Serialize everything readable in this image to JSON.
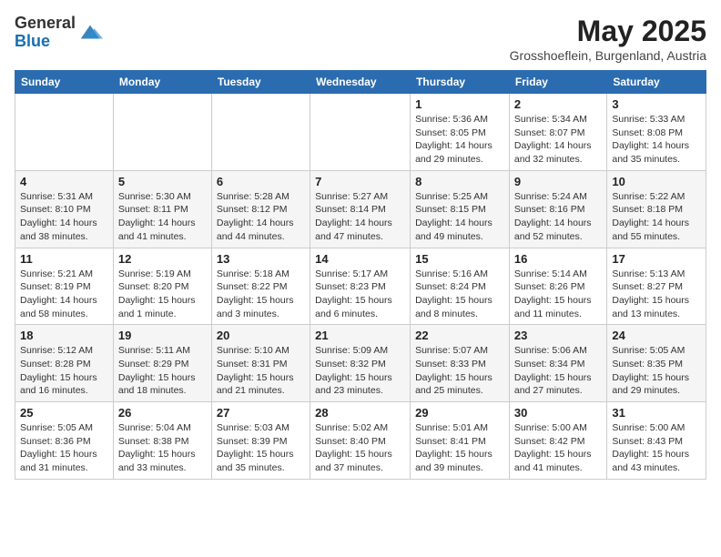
{
  "header": {
    "logo": {
      "line1": "General",
      "line2": "Blue"
    },
    "month": "May 2025",
    "location": "Grosshoeflein, Burgenland, Austria"
  },
  "weekdays": [
    "Sunday",
    "Monday",
    "Tuesday",
    "Wednesday",
    "Thursday",
    "Friday",
    "Saturday"
  ],
  "weeks": [
    [
      {
        "day": "",
        "info": ""
      },
      {
        "day": "",
        "info": ""
      },
      {
        "day": "",
        "info": ""
      },
      {
        "day": "",
        "info": ""
      },
      {
        "day": "1",
        "info": "Sunrise: 5:36 AM\nSunset: 8:05 PM\nDaylight: 14 hours\nand 29 minutes."
      },
      {
        "day": "2",
        "info": "Sunrise: 5:34 AM\nSunset: 8:07 PM\nDaylight: 14 hours\nand 32 minutes."
      },
      {
        "day": "3",
        "info": "Sunrise: 5:33 AM\nSunset: 8:08 PM\nDaylight: 14 hours\nand 35 minutes."
      }
    ],
    [
      {
        "day": "4",
        "info": "Sunrise: 5:31 AM\nSunset: 8:10 PM\nDaylight: 14 hours\nand 38 minutes."
      },
      {
        "day": "5",
        "info": "Sunrise: 5:30 AM\nSunset: 8:11 PM\nDaylight: 14 hours\nand 41 minutes."
      },
      {
        "day": "6",
        "info": "Sunrise: 5:28 AM\nSunset: 8:12 PM\nDaylight: 14 hours\nand 44 minutes."
      },
      {
        "day": "7",
        "info": "Sunrise: 5:27 AM\nSunset: 8:14 PM\nDaylight: 14 hours\nand 47 minutes."
      },
      {
        "day": "8",
        "info": "Sunrise: 5:25 AM\nSunset: 8:15 PM\nDaylight: 14 hours\nand 49 minutes."
      },
      {
        "day": "9",
        "info": "Sunrise: 5:24 AM\nSunset: 8:16 PM\nDaylight: 14 hours\nand 52 minutes."
      },
      {
        "day": "10",
        "info": "Sunrise: 5:22 AM\nSunset: 8:18 PM\nDaylight: 14 hours\nand 55 minutes."
      }
    ],
    [
      {
        "day": "11",
        "info": "Sunrise: 5:21 AM\nSunset: 8:19 PM\nDaylight: 14 hours\nand 58 minutes."
      },
      {
        "day": "12",
        "info": "Sunrise: 5:19 AM\nSunset: 8:20 PM\nDaylight: 15 hours\nand 1 minute."
      },
      {
        "day": "13",
        "info": "Sunrise: 5:18 AM\nSunset: 8:22 PM\nDaylight: 15 hours\nand 3 minutes."
      },
      {
        "day": "14",
        "info": "Sunrise: 5:17 AM\nSunset: 8:23 PM\nDaylight: 15 hours\nand 6 minutes."
      },
      {
        "day": "15",
        "info": "Sunrise: 5:16 AM\nSunset: 8:24 PM\nDaylight: 15 hours\nand 8 minutes."
      },
      {
        "day": "16",
        "info": "Sunrise: 5:14 AM\nSunset: 8:26 PM\nDaylight: 15 hours\nand 11 minutes."
      },
      {
        "day": "17",
        "info": "Sunrise: 5:13 AM\nSunset: 8:27 PM\nDaylight: 15 hours\nand 13 minutes."
      }
    ],
    [
      {
        "day": "18",
        "info": "Sunrise: 5:12 AM\nSunset: 8:28 PM\nDaylight: 15 hours\nand 16 minutes."
      },
      {
        "day": "19",
        "info": "Sunrise: 5:11 AM\nSunset: 8:29 PM\nDaylight: 15 hours\nand 18 minutes."
      },
      {
        "day": "20",
        "info": "Sunrise: 5:10 AM\nSunset: 8:31 PM\nDaylight: 15 hours\nand 21 minutes."
      },
      {
        "day": "21",
        "info": "Sunrise: 5:09 AM\nSunset: 8:32 PM\nDaylight: 15 hours\nand 23 minutes."
      },
      {
        "day": "22",
        "info": "Sunrise: 5:07 AM\nSunset: 8:33 PM\nDaylight: 15 hours\nand 25 minutes."
      },
      {
        "day": "23",
        "info": "Sunrise: 5:06 AM\nSunset: 8:34 PM\nDaylight: 15 hours\nand 27 minutes."
      },
      {
        "day": "24",
        "info": "Sunrise: 5:05 AM\nSunset: 8:35 PM\nDaylight: 15 hours\nand 29 minutes."
      }
    ],
    [
      {
        "day": "25",
        "info": "Sunrise: 5:05 AM\nSunset: 8:36 PM\nDaylight: 15 hours\nand 31 minutes."
      },
      {
        "day": "26",
        "info": "Sunrise: 5:04 AM\nSunset: 8:38 PM\nDaylight: 15 hours\nand 33 minutes."
      },
      {
        "day": "27",
        "info": "Sunrise: 5:03 AM\nSunset: 8:39 PM\nDaylight: 15 hours\nand 35 minutes."
      },
      {
        "day": "28",
        "info": "Sunrise: 5:02 AM\nSunset: 8:40 PM\nDaylight: 15 hours\nand 37 minutes."
      },
      {
        "day": "29",
        "info": "Sunrise: 5:01 AM\nSunset: 8:41 PM\nDaylight: 15 hours\nand 39 minutes."
      },
      {
        "day": "30",
        "info": "Sunrise: 5:00 AM\nSunset: 8:42 PM\nDaylight: 15 hours\nand 41 minutes."
      },
      {
        "day": "31",
        "info": "Sunrise: 5:00 AM\nSunset: 8:43 PM\nDaylight: 15 hours\nand 43 minutes."
      }
    ]
  ]
}
